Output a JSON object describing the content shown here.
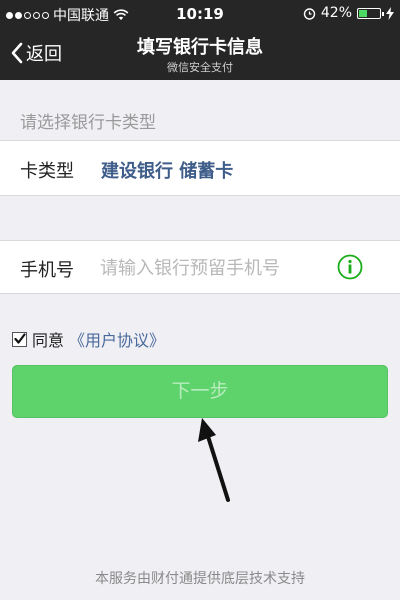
{
  "status_bar": {
    "carrier": "中国联通",
    "time": "10:19",
    "battery_percent": "42%",
    "battery_level": 0.42,
    "signal_bars_full": 2,
    "signal_bars_total": 5
  },
  "nav": {
    "back_label": "返回",
    "title": "填写银行卡信息",
    "subtitle": "微信安全支付"
  },
  "form": {
    "section_hint": "请选择银行卡类型",
    "card_type_label": "卡类型",
    "card_type_value": "建设银行 储蓄卡",
    "phone_label": "手机号",
    "phone_placeholder": "请输入银行预留手机号",
    "phone_value": ""
  },
  "agreement": {
    "checked": true,
    "label": "同意",
    "link_text": "《用户协议》"
  },
  "next_button_label": "下一步",
  "footer_text": "本服务由财付通提供底层技术支持",
  "colors": {
    "header_bg": "#262626",
    "next_button": "#5ed36b",
    "link": "#4a6a9c",
    "info_icon": "#1aad19"
  }
}
